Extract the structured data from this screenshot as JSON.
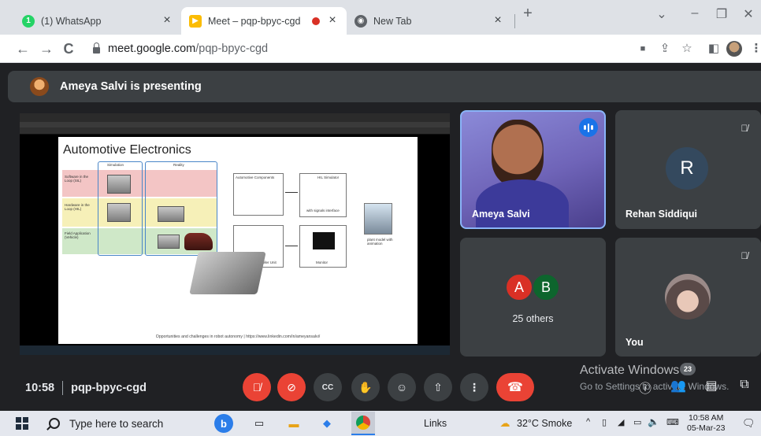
{
  "browser": {
    "tabs": [
      {
        "title": "(1) WhatsApp",
        "icon": "whatsapp-icon",
        "color": "#25d366"
      },
      {
        "title": "Meet – pqp-bpyc-cgd",
        "icon": "google-meet-icon",
        "color": "#00832d"
      },
      {
        "title": "New Tab",
        "icon": "chrome-icon",
        "color": "#5f6368"
      }
    ],
    "url_host": "meet.google.com",
    "url_path": "/pqp-bpyc-cgd"
  },
  "meet": {
    "presenter_text": "Ameya Salvi is presenting",
    "slide": {
      "title": "Automotive Electronics",
      "col_simulation": "Simulation",
      "col_reality": "Reality",
      "row1": "Software in the Loop (SIL)",
      "row2": "Hardware in the Loop (HIL)",
      "row3": "Field Application (Vehicle)",
      "automotive_components": "Automotive Components",
      "hil_simulator": "HIL Simulator",
      "with_signals": "with signals interface",
      "ecu": "Electronic Controller Unit",
      "monitor": "Monitor",
      "plant_model": "plant model with animation",
      "footer": "Opportunities and challenges in robot autonomy | https://www.linkedin.com/in/ameyansalvi/"
    },
    "participants": {
      "ameya": {
        "name": "Ameya Salvi"
      },
      "rehan": {
        "name": "Rehan Siddiqui",
        "initial": "R"
      },
      "others": {
        "label": "25 others",
        "avatars": [
          {
            "letter": "A",
            "color": "#d93025"
          },
          {
            "letter": "B",
            "color": "#0d652d"
          }
        ]
      },
      "you": {
        "name": "You"
      }
    },
    "meeting_time": "10:58",
    "meeting_code": "pqp-bpyc-cgd",
    "chat_badge": "23",
    "activate_title": "Activate Windows",
    "activate_sub": "Go to Settings to activate Windows."
  },
  "taskbar": {
    "search_placeholder": "Type here to search",
    "links_label": "Links",
    "weather": "32°C  Smoke",
    "time": "10:58 AM",
    "date": "05-Mar-23"
  },
  "colors": {
    "meet_bg": "#202124",
    "tile_bg": "#3c4043",
    "end_call": "#ea4335",
    "speaking_blue": "#1a73e8"
  }
}
